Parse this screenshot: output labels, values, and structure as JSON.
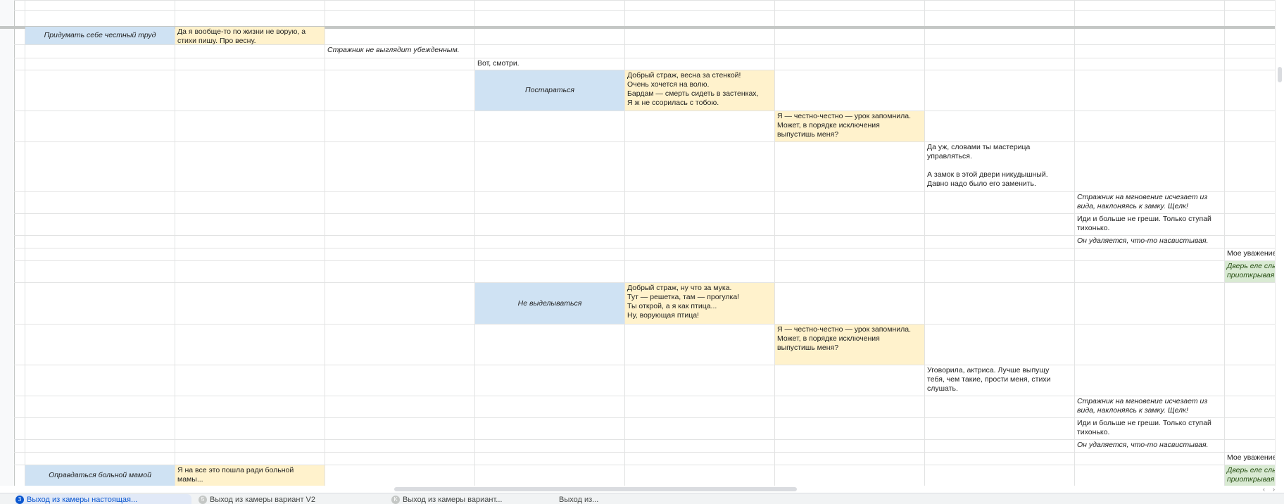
{
  "cells": [
    {
      "text": "Придумать себе честный труд",
      "style": "blue"
    },
    {
      "text": "Да я вообще-то по жизни не ворую, а\nстихи пишу. Про весну.",
      "style": "yellow"
    },
    {
      "text": "Стражник не выглядит убежденным.",
      "style": "ital"
    },
    {
      "text": "Вот, смотри.",
      "style": "plain"
    },
    {
      "text": "Постараться",
      "style": "blue"
    },
    {
      "text": "Добрый страж, весна за стенкой!\nОчень хочется на волю.\nБардам — смерть сидеть в застенках,\nЯ ж не ссорилась с тобою.",
      "style": "yellow"
    },
    {
      "text": "Я — честно-честно — урок запомнила.\nМожет, в порядке исключения\nвыпустишь меня?",
      "style": "yellow"
    },
    {
      "text": "Да уж, словами ты мастерица\nуправляться.\n\nА замок в этой двери никудышный.\nДавно надо было его заменить.",
      "style": "plain"
    },
    {
      "text": "Стражник на мгновение исчезает из\nвида, наклоняясь к замку. Щелк!",
      "style": "ital"
    },
    {
      "text": "Иди и больше не греши. Только ступай\nтихонько.",
      "style": "plain"
    },
    {
      "text": "Он удаляется, что-то насвистывая.",
      "style": "ital"
    },
    {
      "text": "Мое уважение",
      "style": "plain"
    },
    {
      "text": "Дверь еле слы\nприоткрывая",
      "style": "green"
    },
    {
      "text": "Не выделываться",
      "style": "blue"
    },
    {
      "text": "Добрый страж, ну что за мука.\nТут — решетка, там — прогулка!\nТы открой, а я как птица...\nНу, ворующая птица!",
      "style": "yellow"
    },
    {
      "text": "Я — честно-честно — урок запомнила.\nМожет, в порядке исключения\nвыпустишь меня?",
      "style": "yellow"
    },
    {
      "text": "Уговорила, актриса. Лучше выпущу\nтебя, чем такие, прости меня, стихи\nслушать.",
      "style": "plain"
    },
    {
      "text": "Стражник на мгновение исчезает из\nвида, наклоняясь к замку. Щелк!",
      "style": "ital"
    },
    {
      "text": "Иди и больше не греши. Только ступай\nтихонько.",
      "style": "plain"
    },
    {
      "text": "Он удаляется, что-то насвистывая.",
      "style": "ital"
    },
    {
      "text": "Мое уважение",
      "style": "plain"
    },
    {
      "text": "Оправдаться больной мамой",
      "style": "blue"
    },
    {
      "text": "Я на все это пошла ради больной\nмамы...",
      "style": "yellow"
    },
    {
      "text": "Дверь еле слы\nприоткрывая",
      "style": "green"
    }
  ],
  "sheet_tabs": [
    {
      "number": "3",
      "label": "Выход из камеры настоящая...",
      "active": true
    },
    {
      "number": "5",
      "label": "Выход из камеры вариант V2",
      "active": false
    },
    {
      "number": "K",
      "label": "Выход из камеры вариант...",
      "active": false
    },
    {
      "number": "",
      "label": "Выход из...",
      "active": false
    }
  ],
  "colors": {
    "blue": "#cfe2f3",
    "yellow": "#fff2cc",
    "green": "#d9ead3",
    "grid": "#e2e3e3"
  }
}
